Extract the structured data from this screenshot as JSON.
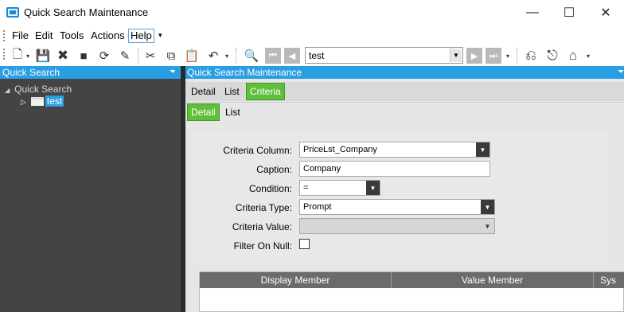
{
  "window": {
    "title": "Quick Search Maintenance"
  },
  "menu": {
    "items": [
      "File",
      "Edit",
      "Tools",
      "Actions",
      "Help"
    ]
  },
  "toolbar": {
    "search_value": "test"
  },
  "left_panel": {
    "title": "Quick Search",
    "tree_root": "Quick Search",
    "tree_child": "test"
  },
  "right_panel": {
    "title": "Quick Search Maintenance",
    "tabs": [
      "Detail",
      "List",
      "Criteria"
    ],
    "subtabs": [
      "Detail",
      "List"
    ]
  },
  "form": {
    "criteria_column": {
      "label": "Criteria Column:",
      "value": "PriceLst_Company"
    },
    "caption": {
      "label": "Caption:",
      "value": "Company"
    },
    "condition": {
      "label": "Condition:",
      "value": "="
    },
    "criteria_type": {
      "label": "Criteria Type:",
      "value": "Prompt"
    },
    "criteria_value": {
      "label": "Criteria Value:",
      "value": ""
    },
    "filter_on_null": {
      "label": "Filter On Null:",
      "checked": false
    }
  },
  "grid": {
    "columns": [
      "Display Member",
      "Value Member",
      "Sys"
    ]
  }
}
